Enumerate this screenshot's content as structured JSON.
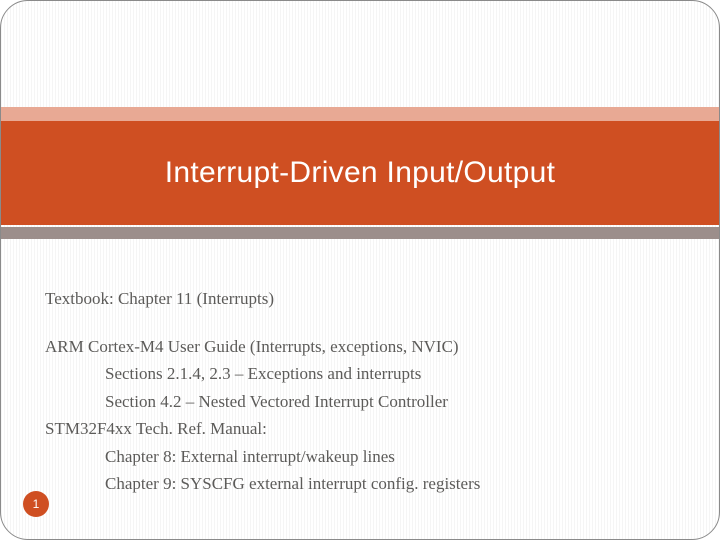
{
  "slide": {
    "title": "Interrupt-Driven Input/Output",
    "page_number": "1",
    "body": {
      "line1": "Textbook:  Chapter 11 (Interrupts)",
      "line2": "ARM Cortex-M4 User Guide (Interrupts, exceptions, NVIC)",
      "line3": "Sections 2.1.4, 2.3 – Exceptions and interrupts",
      "line4": "Section 4.2 – Nested Vectored Interrupt Controller",
      "line5": "STM32F4xx Tech. Ref. Manual:",
      "line6": "Chapter 8: External interrupt/wakeup lines",
      "line7": "Chapter 9: SYSCFG external interrupt config. registers"
    }
  }
}
